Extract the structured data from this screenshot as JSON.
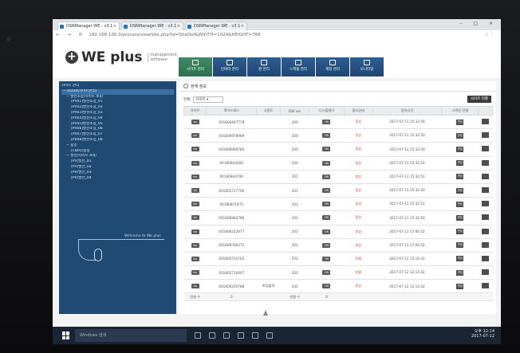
{
  "browser": {
    "tabs": [
      "DSNManager WE - v3.1",
      "DSNManager WE - v3.1",
      "DSNManager WE - v3.1"
    ],
    "url": "192.168.100.3/process/viewSite.php?id=SiteDef&WIDTH=1024&HEIGHT=768"
  },
  "app": {
    "logo_name": "WE plus",
    "logo_sub": "management software",
    "menu": [
      "사이트 관리",
      "인버터 관리",
      "판 관리",
      "스케줄 관리",
      "계정 관리",
      "모니터링"
    ]
  },
  "sidebar": {
    "items": [
      "사이트 관리",
      "− Rootd(사이트관리)",
      "− 발전소장(사이트 4대)",
      "[PV01]발전소장_01",
      "[PV02]발전소장_02",
      "[PV03]발전소장_03",
      "[PV04]발전소장_04",
      "[PV05]발전소장_05",
      "[PV06]발전소장_06",
      "[PV07]발전소장_07",
      "[PV08]발전소장_08",
      "− 중앙",
      "[CB01]중앙",
      "− 발전(사이트 4대)",
      "[PV]발전_01",
      "[PV]발전_02",
      "[PV]발전_03",
      "[PV]발전_04"
    ],
    "welcome": "Welcome to We plus"
  },
  "content": {
    "title": "현재 정보",
    "filter_label": "전체",
    "filter_value": "사이트 ▾",
    "site_button": "사이트 현황",
    "headers": [
      "사이트",
      "맥어드레스",
      "고정도",
      "DW ver",
      "디스플레이",
      "접속상태",
      "접속시간",
      "고객정 연결",
      ""
    ],
    "rows": [
      [
        "kw",
        "001806497778",
        "",
        "200",
        "ON",
        "정상",
        "2017-07-11 15:32:56"
      ],
      [
        "kw",
        "001806978969",
        "",
        "200",
        "ON",
        "정상",
        "2017-07-11 15:32:50"
      ],
      [
        "kw",
        "001806998780",
        "",
        "200",
        "ON",
        "정상",
        "2017-07-11 15:32:50"
      ],
      [
        "kw",
        "00180B43460",
        "",
        "200",
        "ON",
        "정상",
        "2017-07-11 15:32:52"
      ],
      [
        "kw",
        "00180B44790",
        "",
        "201",
        "ON",
        "정상",
        "2017-07-11 15:32:51"
      ],
      [
        "kw",
        "001805717706",
        "",
        "201",
        "ON",
        "정상",
        "2017-07-11 15:32:50"
      ],
      [
        "kw",
        "00180B71972",
        "",
        "201",
        "ON",
        "정상",
        "2017-07-11 15:32:51"
      ],
      [
        "kw",
        "00180B484780",
        "",
        "201",
        "ON",
        "정상",
        "2017-07-11 15:32:50"
      ],
      [
        "kw",
        "001806222977",
        "",
        "202",
        "ON",
        "정상",
        "2017-07-11 17:00:52"
      ],
      [
        "kw",
        "00180B780271",
        "",
        "202",
        "ON",
        "정상",
        "2017-07-11 17:00:52"
      ],
      [
        "kw",
        "001805720702",
        "",
        "202",
        "ON",
        "연결",
        "2017-07-12 12:14:41"
      ],
      [
        "kw",
        "001805716407",
        "",
        "202",
        "ON",
        "연결",
        "2017-07-12 12:14:42"
      ],
      [
        "kw",
        "001806205788",
        "확정출력",
        "202",
        "ON",
        "정상",
        "2017-07-12 12:14:42"
      ]
    ],
    "footer": [
      "연결 수",
      "3",
      "연결 수",
      "0"
    ],
    "edit_label": "편집"
  },
  "taskbar": {
    "search": "Windows 검색",
    "time": "오후 12:14",
    "date": "2017-07-12"
  },
  "colors": {
    "sidebar": "#1f4a74",
    "menu": "#1d4673",
    "menu_active": "#2f6f4f"
  }
}
